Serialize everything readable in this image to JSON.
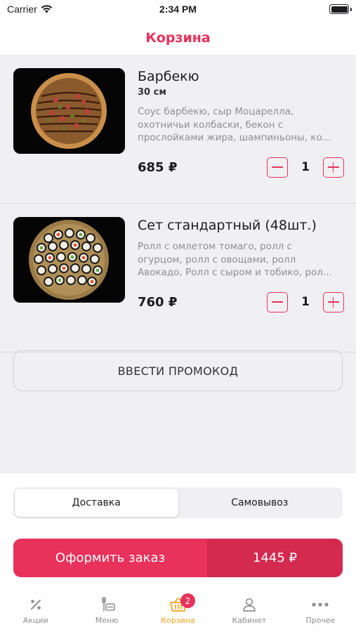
{
  "status_bar": {
    "carrier": "Carrier",
    "time": "2:34 PM"
  },
  "header": {
    "title": "Корзина"
  },
  "cart": {
    "items": [
      {
        "name": "Барбекю",
        "size": "30 см",
        "description_lines": [
          "Соус барбекю, сыр Моцарелла,",
          "охотничьи колбаски, бекон с",
          "прослойками жира, шампиньоны, ко..."
        ],
        "price": "685 ₽",
        "quantity": "1"
      },
      {
        "name": "Сет стандартный (48шт.)",
        "description_lines": [
          "Ролл с омлетом томаго, ролл с",
          "огурцом, ролл с овощами, ролл",
          "Авокадо, Ролл с сыром и тобико, рол..."
        ],
        "price": "760 ₽",
        "quantity": "1"
      }
    ],
    "promo_label": "ВВЕСТИ ПРОМОКОД"
  },
  "delivery_options": {
    "selected": "Доставка",
    "options": [
      "Доставка",
      "Самовывоз"
    ]
  },
  "order": {
    "label": "Оформить заказ",
    "total": "1445 ₽"
  },
  "tabbar": {
    "items": [
      {
        "label": "Акции",
        "icon": "percent-icon"
      },
      {
        "label": "Меню",
        "icon": "menu-food-icon"
      },
      {
        "label": "Корзина",
        "icon": "basket-icon",
        "badge": "2"
      },
      {
        "label": "Кабинет",
        "icon": "person-icon"
      },
      {
        "label": "Прочее",
        "icon": "more-dots-icon"
      }
    ]
  },
  "colors": {
    "accent": "#e8315b",
    "accent_dark": "#d42a50",
    "active_tab": "#f2a11a",
    "muted": "#8e8e93"
  }
}
